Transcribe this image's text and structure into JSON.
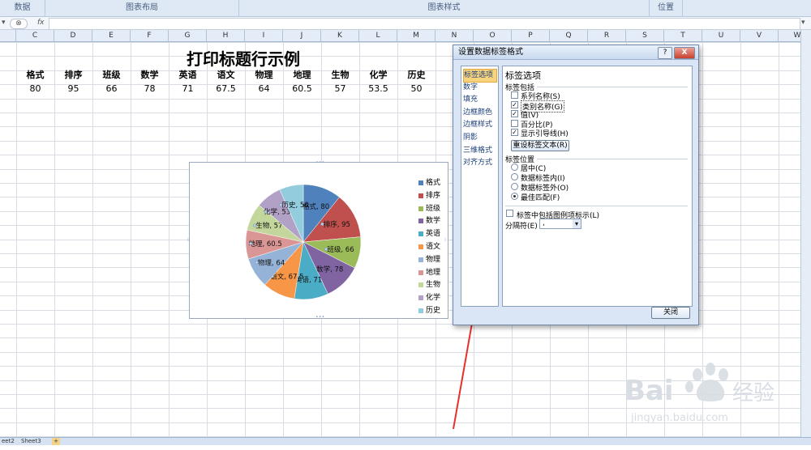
{
  "ribbon": {
    "groups": [
      {
        "label": "数据"
      },
      {
        "label": "图表布局"
      },
      {
        "label": "图表样式"
      },
      {
        "label": "位置"
      }
    ]
  },
  "formula_bar": {
    "fx": "fx"
  },
  "columns": [
    "C",
    "D",
    "E",
    "F",
    "G",
    "H",
    "I",
    "J",
    "K",
    "L",
    "M",
    "N",
    "O",
    "P",
    "Q",
    "R",
    "S",
    "T",
    "U",
    "V",
    "W"
  ],
  "sheet": {
    "title": "打印标题行示例",
    "headers": [
      "格式",
      "排序",
      "班级",
      "数学",
      "英语",
      "语文",
      "物理",
      "地理",
      "生物",
      "化学",
      "历史"
    ],
    "values": [
      "80",
      "95",
      "66",
      "78",
      "71",
      "67.5",
      "64",
      "60.5",
      "57",
      "53.5",
      "50"
    ]
  },
  "chart_data": {
    "type": "pie",
    "categories": [
      "格式",
      "排序",
      "班级",
      "数学",
      "英语",
      "语文",
      "物理",
      "地理",
      "生物",
      "化学",
      "历史"
    ],
    "values": [
      80,
      95,
      66,
      78,
      71,
      67.5,
      64,
      60.5,
      57,
      53.5,
      50
    ],
    "colors": [
      "#4f81bd",
      "#c0504d",
      "#9bbb59",
      "#8064a2",
      "#4bacc6",
      "#f79646",
      "#95b3d7",
      "#d99694",
      "#c3d69b",
      "#b2a1c7",
      "#93cddd"
    ],
    "data_labels": [
      "格式, 80",
      "排序, 95",
      "班级, 66",
      "数学, 78",
      "英语, 71",
      "语文, 67.5",
      "物理, 64",
      "地理, 60.5",
      "生物, 57",
      "化学, 53.5",
      "历史, 50"
    ],
    "legend_position": "right"
  },
  "dialog": {
    "title": "设置数据标签格式",
    "help_label": "?",
    "close_label": "X",
    "nav": [
      "标签选项",
      "数字",
      "填充",
      "边框颜色",
      "边框样式",
      "阴影",
      "三维格式",
      "对齐方式"
    ],
    "panel_heading": "标签选项",
    "section_contains": "标签包括",
    "checkboxes": [
      {
        "label": "系列名称(S)",
        "checked": false
      },
      {
        "label": "类别名称(G)",
        "checked": true
      },
      {
        "label": "值(V)",
        "checked": true
      },
      {
        "label": "百分比(P)",
        "checked": false
      },
      {
        "label": "显示引导线(H)",
        "checked": true
      }
    ],
    "reset_button": "重设标签文本(R)",
    "section_position": "标签位置",
    "radios": [
      {
        "label": "居中(C)",
        "selected": false
      },
      {
        "label": "数据标签内(I)",
        "selected": false
      },
      {
        "label": "数据标签外(O)",
        "selected": false
      },
      {
        "label": "最佳匹配(F)",
        "selected": true
      }
    ],
    "legend_key_label": "标签中包括图例项标示(L)",
    "separator_label": "分隔符(E)",
    "separator_value": ",",
    "close_button": "关闭"
  },
  "sheet_tabs": [
    "eet2",
    "Sheet3"
  ],
  "watermark": {
    "brand": "Bai 经验",
    "url": "jingyan.baidu.com"
  }
}
